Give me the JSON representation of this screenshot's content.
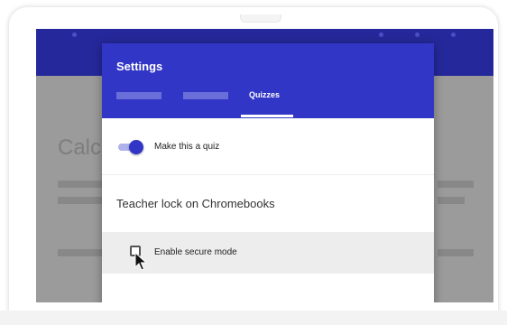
{
  "dialog": {
    "title": "Settings",
    "tabs": [
      {
        "label": ""
      },
      {
        "label": ""
      },
      {
        "label": "Quizzes",
        "active": true
      }
    ]
  },
  "quiz_toggle": {
    "label": "Make this a quiz",
    "on": true
  },
  "teacher_lock": {
    "heading": "Teacher lock on Chromebooks",
    "secure_mode_label": "Enable secure mode",
    "secure_mode_checked": false
  },
  "background": {
    "title_fragment": "Calc"
  },
  "colors": {
    "app_bar": "#25289a",
    "dialog_header": "#3236c6",
    "toggle_on": "#3236c6"
  }
}
